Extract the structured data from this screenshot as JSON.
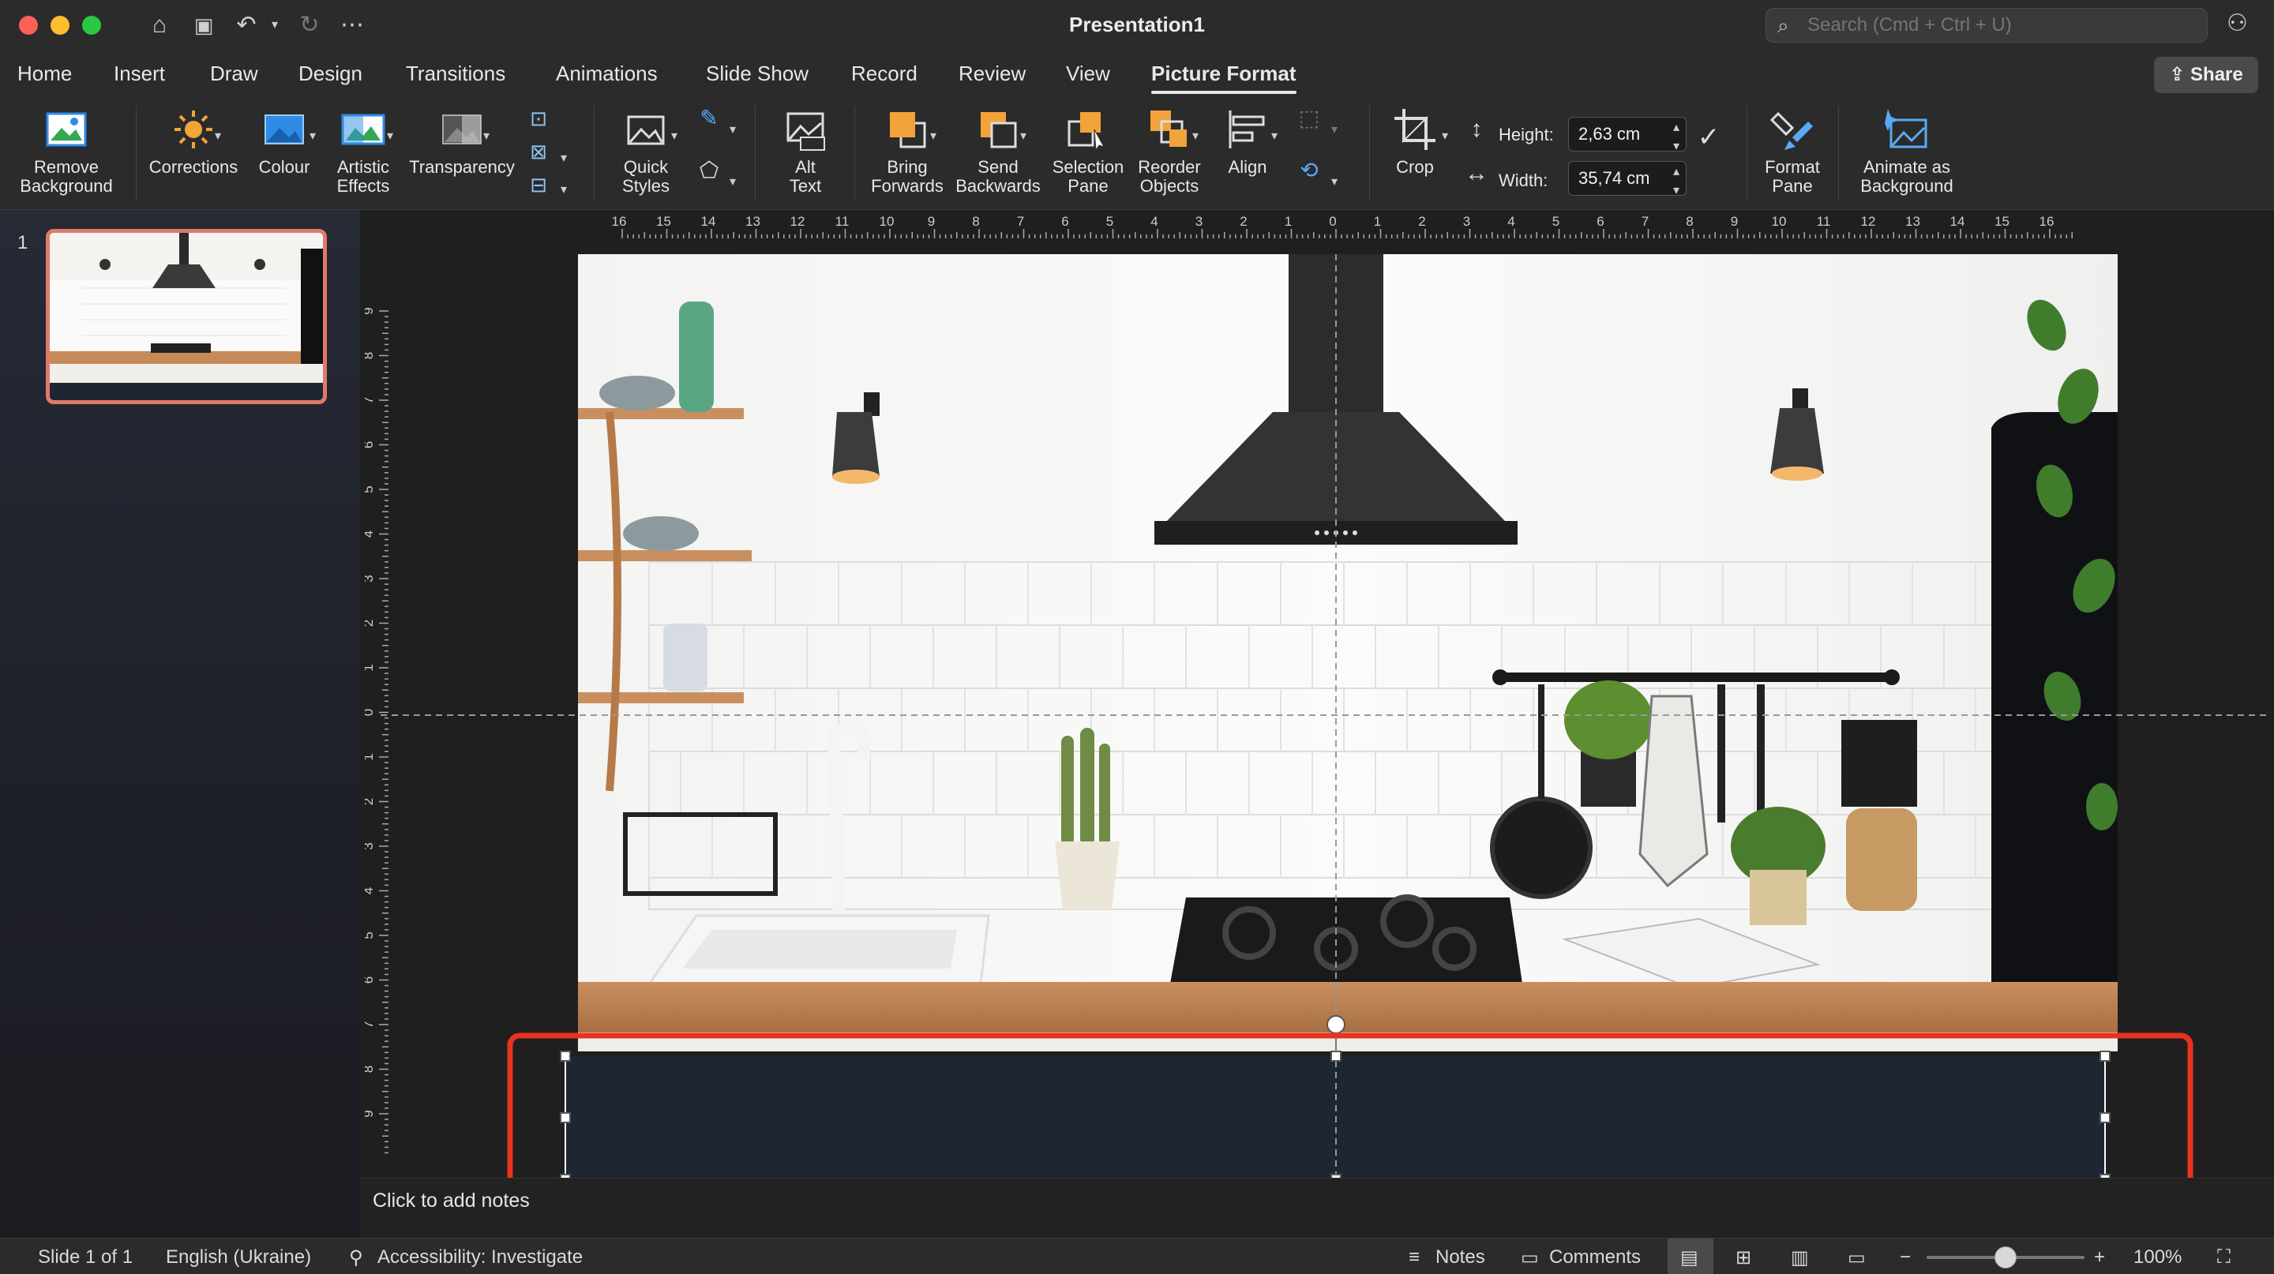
{
  "window": {
    "title": "Presentation1",
    "search_placeholder": "Search (Cmd + Ctrl + U)"
  },
  "tabs": [
    {
      "label": "Home"
    },
    {
      "label": "Insert"
    },
    {
      "label": "Draw"
    },
    {
      "label": "Design"
    },
    {
      "label": "Transitions"
    },
    {
      "label": "Animations"
    },
    {
      "label": "Slide Show"
    },
    {
      "label": "Record"
    },
    {
      "label": "Review"
    },
    {
      "label": "View"
    },
    {
      "label": "Picture Format",
      "active": true
    }
  ],
  "share_label": "Share",
  "ribbon": {
    "remove_background": [
      "Remove",
      "Background"
    ],
    "corrections": "Corrections",
    "colour": "Colour",
    "artistic_effects": [
      "Artistic",
      "Effects"
    ],
    "transparency": "Transparency",
    "quick_styles": [
      "Quick",
      "Styles"
    ],
    "alt_text": [
      "Alt",
      "Text"
    ],
    "bring_forwards": [
      "Bring",
      "Forwards"
    ],
    "send_backwards": [
      "Send",
      "Backwards"
    ],
    "selection_pane": [
      "Selection",
      "Pane"
    ],
    "reorder_objects": [
      "Reorder",
      "Objects"
    ],
    "align": "Align",
    "crop": "Crop",
    "height_label": "Height:",
    "height_value": "2,63 cm",
    "width_label": "Width:",
    "width_value": "35,74 cm",
    "format_pane": [
      "Format",
      "Pane"
    ],
    "animate_as_background": [
      "Animate as",
      "Background"
    ]
  },
  "slide_panel": {
    "slide_number": "1"
  },
  "rulers": {
    "horizontal": [
      "16",
      "15",
      "14",
      "13",
      "12",
      "11",
      "10",
      "9",
      "8",
      "7",
      "6",
      "5",
      "4",
      "3",
      "2",
      "1",
      "0",
      "1",
      "2",
      "3",
      "4",
      "5",
      "6",
      "7",
      "8",
      "9",
      "10",
      "11",
      "12",
      "13",
      "14",
      "15",
      "16"
    ],
    "vertical": [
      "9",
      "8",
      "7",
      "6",
      "5",
      "4",
      "3",
      "2",
      "1",
      "0",
      "1",
      "2",
      "3",
      "4",
      "5",
      "6",
      "7",
      "8",
      "9"
    ]
  },
  "notes_placeholder": "Click to add notes",
  "status": {
    "slide": "Slide 1 of 1",
    "language": "English (Ukraine)",
    "accessibility": "Accessibility: Investigate",
    "notes": "Notes",
    "comments": "Comments",
    "zoom": "100%",
    "zoom_level_fraction": 0.5
  },
  "colors": {
    "selection_highlight": "#e8321f",
    "shape_fill": "#1e2533",
    "ribbon_accent": "#f2a33a"
  }
}
